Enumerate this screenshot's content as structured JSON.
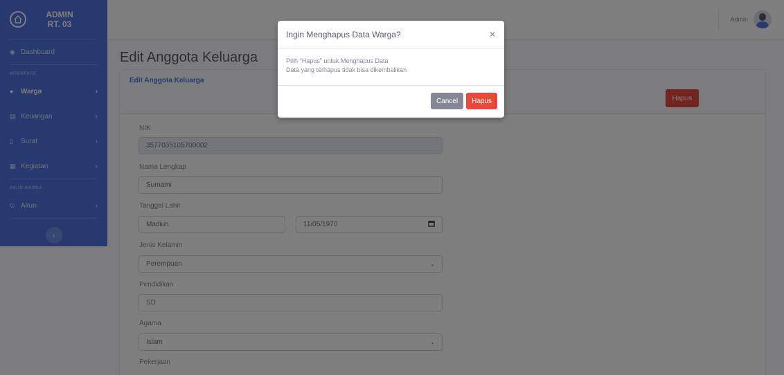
{
  "sidebar": {
    "brand": "ADMIN RT. 03",
    "items": [
      {
        "label": "Dashboard"
      },
      {
        "label": "Warga"
      },
      {
        "label": "Keuangan"
      },
      {
        "label": "Surat"
      },
      {
        "label": "Kegiatan"
      },
      {
        "label": "Akun"
      }
    ],
    "heading_interface": "INTERFACE",
    "heading_akun": "AKUN WARGA"
  },
  "topbar": {
    "user": "Admin"
  },
  "page": {
    "title": "Edit Anggota Keluarga"
  },
  "card": {
    "title": "Edit Anggota Keluarga",
    "hapus_label": "Hapus"
  },
  "form": {
    "nik_label": "NIK",
    "nik_value": "3577035105700002",
    "nama_label": "Nama Lengkap",
    "nama_value": "Sumami",
    "ttl_label": "Tanggal Lahir",
    "tempat_value": "Madiun",
    "tanggal_value": "11/05/1970",
    "jk_label": "Jenis Kelamin",
    "jk_value": "Perempuan",
    "pendidikan_label": "Pendidikan",
    "pendidikan_value": "SD",
    "agama_label": "Agama",
    "agama_value": "Islam",
    "pekerjaan_label": "Pekerjaan"
  },
  "modal": {
    "title": "Ingin Menghapus Data Warga?",
    "body_line1": "Pilih \"Hapus\" untuk Menghapus Data",
    "body_line2": "Data yang terhapus tidak bisa dikembalikan",
    "cancel_label": "Cancel",
    "hapus_label": "Hapus"
  },
  "colors": {
    "primary": "#4e73df",
    "danger": "#e74a3b",
    "secondary": "#858796"
  }
}
